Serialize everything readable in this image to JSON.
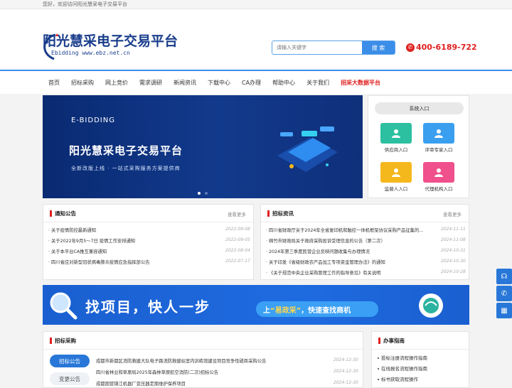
{
  "topbar": {
    "welcome": "您好，欢迎访问阳光慧采电子交易平台"
  },
  "logo": {
    "title": "阳光慧采电子交易平台",
    "sub": "Ebidding  www.ebz.net.cn"
  },
  "search": {
    "placeholder": "请输入关键字",
    "button": "搜 索"
  },
  "hotline": {
    "number": "400-6189-722"
  },
  "nav": {
    "items": [
      "首页",
      "招标采购",
      "网上竞价",
      "需求调研",
      "新闻资讯",
      "下载中心",
      "CA办理",
      "帮助中心",
      "关于我们",
      "招采大数据平台"
    ]
  },
  "banner": {
    "eb": "E-BIDDING",
    "title": "阳光慧采电子交易平台",
    "subtitle": "全新改版上线 · 一站式采购服务方案提供商"
  },
  "system": {
    "title": "系统入口",
    "entries": [
      {
        "label": "供应商入口",
        "color": "#2cc0a0"
      },
      {
        "label": "评审专家入口",
        "color": "#3b9ff0"
      },
      {
        "label": "监督人入口",
        "color": "#f5b81c"
      },
      {
        "label": "代理机构入口",
        "color": "#f0508c"
      }
    ]
  },
  "notice": {
    "title": "通知公告",
    "more": "查看更多",
    "rows": [
      {
        "text": "关于疫情防控最新通知",
        "date": "2022-09-08"
      },
      {
        "text": "关于2022年9月5～7日 疫情工作安排通知",
        "date": "2022-09-05"
      },
      {
        "text": "关于本平台CA推互兼容通知",
        "date": "2022-08-04"
      },
      {
        "text": "四川省应对新型冠状病毒肺炎疫情应急指挥部公告",
        "date": "2022-07-17"
      }
    ]
  },
  "news": {
    "title": "招标资讯",
    "more": "查看更多",
    "rows": [
      {
        "text": "四川省财政厅关于2024年全省复印机和触控一体机框架协议采购产品征集的...",
        "date": "2024-11-11"
      },
      {
        "text": "绵竹市财政局关于政府采购投诉受理信息的公告（第二次）",
        "date": "2024-11-08"
      },
      {
        "text": "2024年第三季度民营企业反映问题收集与办理情况",
        "date": "2024-10-31"
      },
      {
        "text": "关于印发《省级财政农产品加工专项资金管理办法》的通知",
        "date": "2024-10-30"
      },
      {
        "text": "《关于规范中央企业采购管理工作的指导意见》有关说明",
        "date": "2024-10-28"
      }
    ]
  },
  "ad": {
    "big": "找项目，快人一步",
    "slogan_pre": "上",
    "slogan_y": "“易政采”",
    "slogan_post": "，快速查找商机"
  },
  "tender": {
    "title": "招标采购",
    "tabs": [
      "招标公告",
      "变更公告"
    ],
    "rows": [
      {
        "text": "成都市新都区消防救援大队电子路消防救援站室内训练馆建设项目竞争性磋商采购公告",
        "date": "2024-12-30"
      },
      {
        "text": "四川省林业和草原局2025年森林草原航空消防(二次)招标公告",
        "date": "2024-12-30"
      },
      {
        "text": "成都国营锦江机器厂变压器定期维护保养项目",
        "date": "2024-12-30"
      }
    ]
  },
  "guide": {
    "title": "办事指南",
    "rows": [
      "投标注册流程操作指南",
      "在线报名流程操作指南",
      "标书获取流程操作"
    ]
  },
  "side": {
    "icons": [
      "headset-icon",
      "phone-icon",
      "qrcode-icon"
    ]
  }
}
